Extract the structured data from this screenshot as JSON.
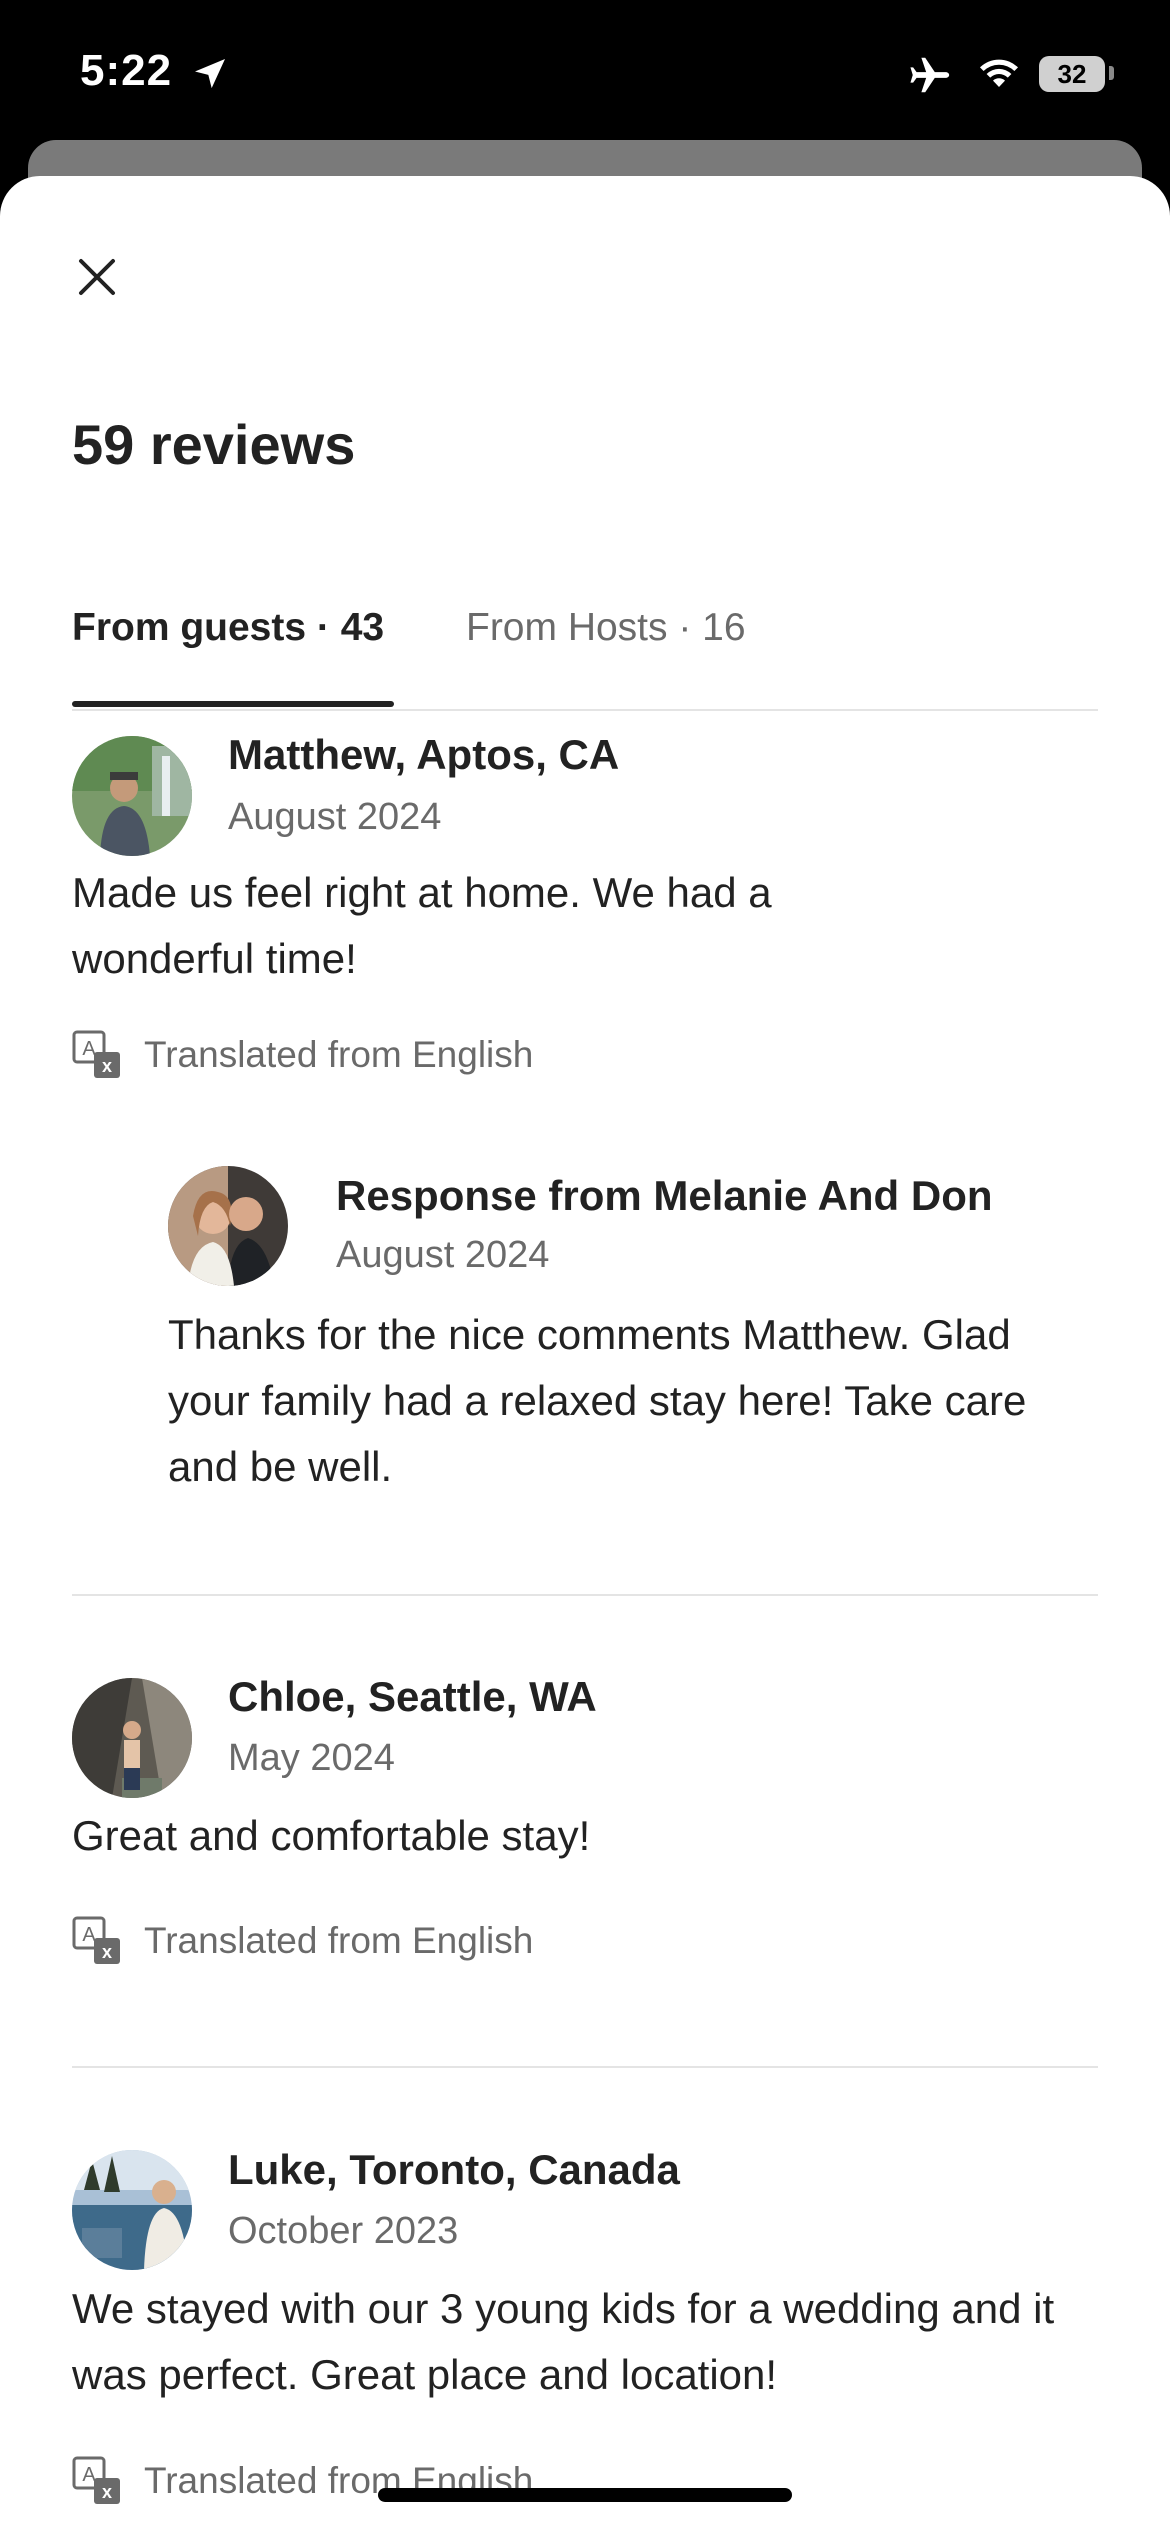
{
  "status_bar": {
    "time": "5:22",
    "battery": "32"
  },
  "sheet": {
    "title": "59 reviews",
    "tabs": [
      {
        "label": "From guests · 43",
        "active": true
      },
      {
        "label": "From Hosts · 16",
        "active": false
      }
    ]
  },
  "reviews": [
    {
      "name": "Matthew, Aptos, CA",
      "date": "August 2024",
      "text": "Made us feel right at home. We had a wonderful time!",
      "translated": "Translated from English",
      "response": {
        "name": "Response from Melanie And Don",
        "date": "August 2024",
        "text": "Thanks for the nice comments Matthew. Glad your family had a relaxed stay here! Take care and be well."
      }
    },
    {
      "name": "Chloe, Seattle, WA",
      "date": "May 2024",
      "text": "Great and comfortable stay!",
      "translated": "Translated from English"
    },
    {
      "name": "Luke, Toronto, Canada",
      "date": "October 2023",
      "text": "We stayed with our 3 young kids for a wedding and it was perfect. Great place and location!",
      "translated": "Translated from English"
    }
  ],
  "colors": {
    "text_primary": "#222222",
    "text_secondary": "#6a6a6a",
    "divider": "#e4e4e4"
  },
  "icons": [
    "location-arrow-icon",
    "airplane-icon",
    "wifi-icon",
    "close-icon",
    "translate-icon"
  ]
}
